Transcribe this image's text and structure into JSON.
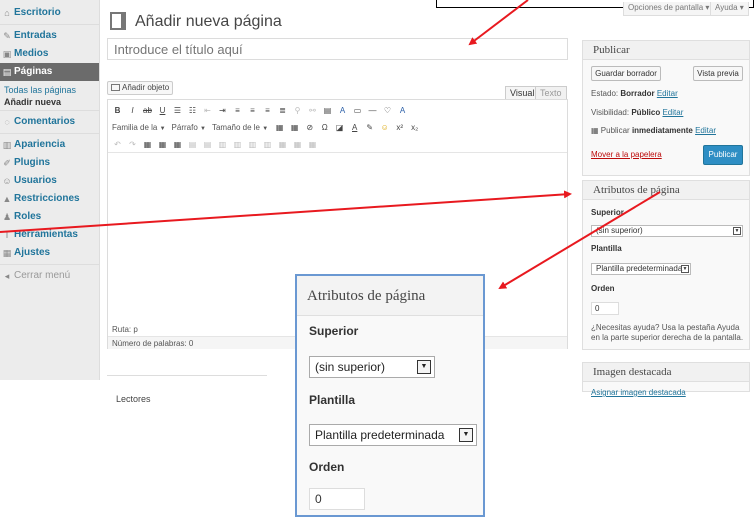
{
  "sidebar": {
    "items": [
      {
        "icon": "dashboard-icon",
        "glyph": "⌂",
        "label": "Escritorio"
      },
      {
        "icon": "pin-icon",
        "glyph": "✎",
        "label": "Entradas"
      },
      {
        "icon": "media-icon",
        "glyph": "▣",
        "label": "Medios"
      },
      {
        "icon": "pages-icon",
        "glyph": "▤",
        "label": "Páginas"
      }
    ],
    "subitems": [
      "Todas las páginas",
      "Añadir nueva"
    ],
    "items2": [
      {
        "icon": "comments-icon",
        "glyph": "◌",
        "label": "Comentarios"
      },
      {
        "icon": "appearance-icon",
        "glyph": "▥",
        "label": "Apariencia"
      },
      {
        "icon": "plugins-icon",
        "glyph": "✐",
        "label": "Plugins"
      },
      {
        "icon": "users-icon",
        "glyph": "☺",
        "label": "Usuarios"
      },
      {
        "icon": "restrictions-icon",
        "glyph": "▲",
        "label": "Restricciones"
      },
      {
        "icon": "roles-icon",
        "glyph": "♟",
        "label": "Roles"
      },
      {
        "icon": "tools-icon",
        "glyph": "T",
        "label": "Herramientas"
      },
      {
        "icon": "settings-icon",
        "glyph": "▦",
        "label": "Ajustes"
      }
    ],
    "collapse": "Cerrar menú"
  },
  "header": {
    "title": "Añadir nueva página",
    "screen_options": "Opciones de pantalla",
    "help": "Ayuda"
  },
  "editor": {
    "title_placeholder": "Introduce el título aquí",
    "add_object": "Añadir objeto",
    "tab_visual": "Visual",
    "tab_text": "Texto",
    "font_family": "Familia de la",
    "format": "Párrafo",
    "font_size": "Tamaño de le",
    "path": "Ruta: p",
    "word_count": "Número de palabras: 0"
  },
  "lectores": "Lectores",
  "publish": {
    "title": "Publicar",
    "save_draft": "Guardar borrador",
    "preview": "Vista previa",
    "status_label": "Estado:",
    "status_value": "Borrador",
    "visibility_label": "Visibilidad:",
    "visibility_value": "Público",
    "publish_label": "Publicar",
    "publish_value": "inmediatamente",
    "edit": "Editar",
    "trash": "Mover a la papelera",
    "publish_btn": "Publicar"
  },
  "attributes": {
    "title": "Atributos de página",
    "parent_label": "Superior",
    "parent_value": "(sin superior)",
    "template_label": "Plantilla",
    "template_value": "Plantilla predeterminada",
    "order_label": "Orden",
    "order_value": "0",
    "help": "¿Necesitas ayuda? Usa la pestaña Ayuda en la parte superior derecha de la pantalla."
  },
  "featured_image": {
    "title": "Imagen destacada",
    "link": "Asignar imagen destacada"
  },
  "colors": {
    "link": "#21759b",
    "active_menu": "#6b6b6b",
    "primary_button": "#2e8ec4",
    "arrow": "#e8191f",
    "zoom_border": "#6a98d2"
  }
}
